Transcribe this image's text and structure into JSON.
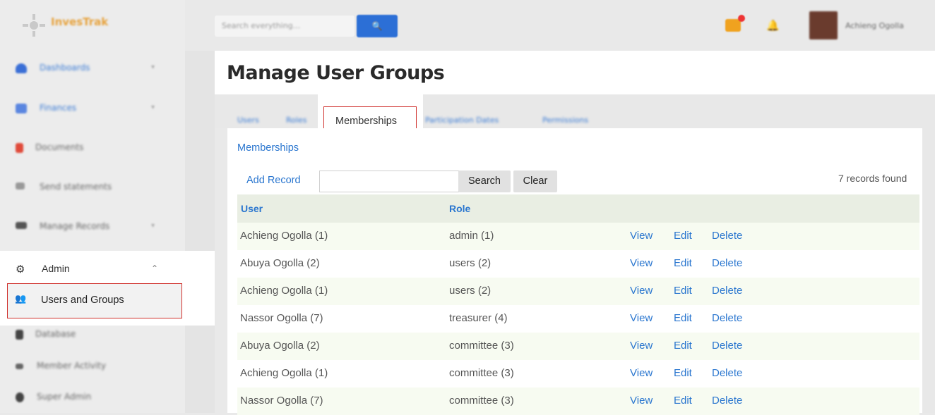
{
  "app": {
    "logo_text": "InvesTrak"
  },
  "topbar": {
    "search_placeholder": "Search everything...",
    "search_button": "🔍",
    "user_name": "Achieng Ogolla"
  },
  "sidebar": {
    "items": [
      {
        "label": "Dashboards",
        "icon": "cloud-icon"
      },
      {
        "label": "Finances",
        "icon": "table-icon"
      },
      {
        "label": "Documents",
        "icon": "document-icon"
      },
      {
        "label": "Send statements",
        "icon": "send-icon"
      },
      {
        "label": "Manage Records",
        "icon": "records-icon"
      }
    ],
    "admin": {
      "label": "Admin",
      "icon": "cogs-icon",
      "sub_item": "Users and Groups"
    },
    "items_after": [
      {
        "label": "Database",
        "icon": "database-icon"
      },
      {
        "label": "Member Activity",
        "icon": "activity-icon"
      },
      {
        "label": "Super Admin",
        "icon": "superadmin-icon"
      }
    ]
  },
  "page": {
    "title": "Manage User Groups"
  },
  "tabs": {
    "users": "Users",
    "roles": "Roles",
    "active": "Memberships",
    "participation": "Participation Dates",
    "permissions": "Permissions"
  },
  "content": {
    "breadcrumb": "Memberships",
    "add_record": "Add Record",
    "search_button": "Search",
    "clear_button": "Clear",
    "records_found": "7 records found",
    "columns": {
      "user": "User",
      "role": "Role"
    },
    "actions": {
      "view": "View",
      "edit": "Edit",
      "delete": "Delete"
    },
    "rows": [
      {
        "user": "Achieng Ogolla (1)",
        "role": "admin (1)"
      },
      {
        "user": "Abuya Ogolla (2)",
        "role": "users (2)"
      },
      {
        "user": "Achieng Ogolla (1)",
        "role": "users (2)"
      },
      {
        "user": "Nassor Ogolla (7)",
        "role": "treasurer (4)"
      },
      {
        "user": "Abuya Ogolla (2)",
        "role": "committee (3)"
      },
      {
        "user": "Achieng Ogolla (1)",
        "role": "committee (3)"
      },
      {
        "user": "Nassor Ogolla (7)",
        "role": "committee (3)"
      }
    ]
  },
  "colors": {
    "accent": "#2a76cf",
    "highlight": "#d0312d",
    "search_button": "#2c6fd6"
  }
}
